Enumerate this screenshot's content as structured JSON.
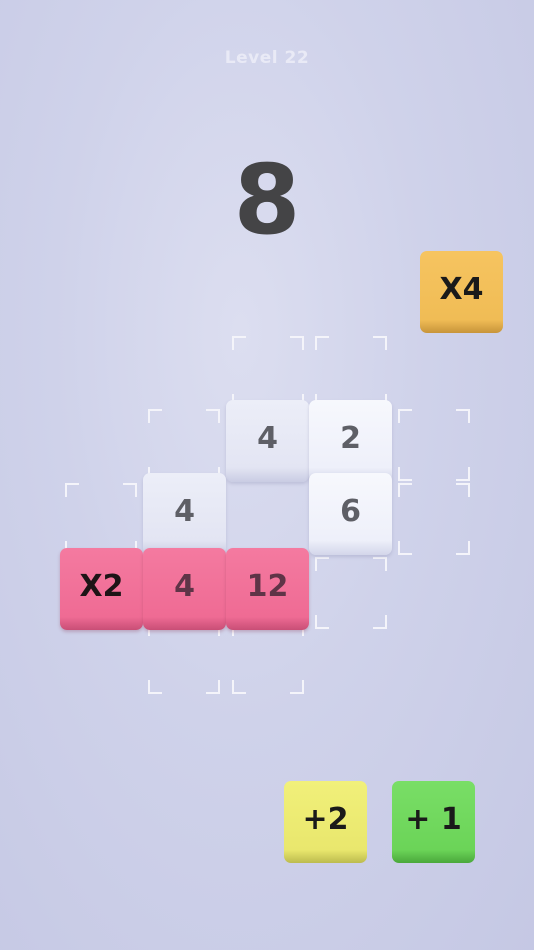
{
  "header": {
    "level_label": "Level 22",
    "target_number": "8"
  },
  "held_tile": {
    "label": "X4",
    "color": "#f0bc55"
  },
  "board": {
    "tiles": [
      {
        "label": "4",
        "color": "#eef0fa"
      },
      {
        "label": "2",
        "color": "#f7f8fd"
      },
      {
        "label": "4",
        "color": "#eef0fa"
      },
      {
        "label": "6",
        "color": "#f7f8fd"
      },
      {
        "label": "X2",
        "color": "#ef6b94"
      },
      {
        "label": "4",
        "color": "#ef6b94"
      },
      {
        "label": "12",
        "color": "#ef6b94"
      }
    ]
  },
  "tray": {
    "tiles": [
      {
        "label": "+2",
        "color": "#e9e76d"
      },
      {
        "label": "+ 1",
        "color": "#6bd458"
      }
    ]
  }
}
